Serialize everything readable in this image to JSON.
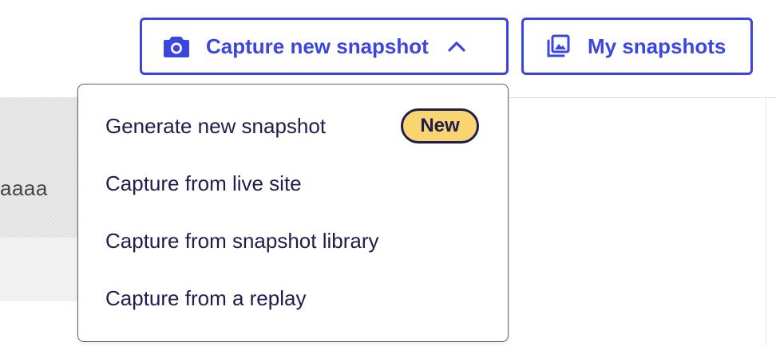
{
  "toolbar": {
    "capture_label": "Capture new snapshot",
    "snapshots_label": "My snapshots",
    "accent_color": "#3b45e2"
  },
  "background": {
    "card_text": "aaaa"
  },
  "menu": {
    "items": [
      {
        "label": "Generate new snapshot",
        "badge": "New"
      },
      {
        "label": "Capture from live site"
      },
      {
        "label": "Capture from snapshot library"
      },
      {
        "label": "Capture from a replay"
      }
    ],
    "badge_color": "#f8d570",
    "text_color": "#1f1d4e"
  },
  "icons": {
    "capture": "camera-icon",
    "snapshots": "photo-library-icon",
    "toggle": "chevron-up-icon"
  }
}
